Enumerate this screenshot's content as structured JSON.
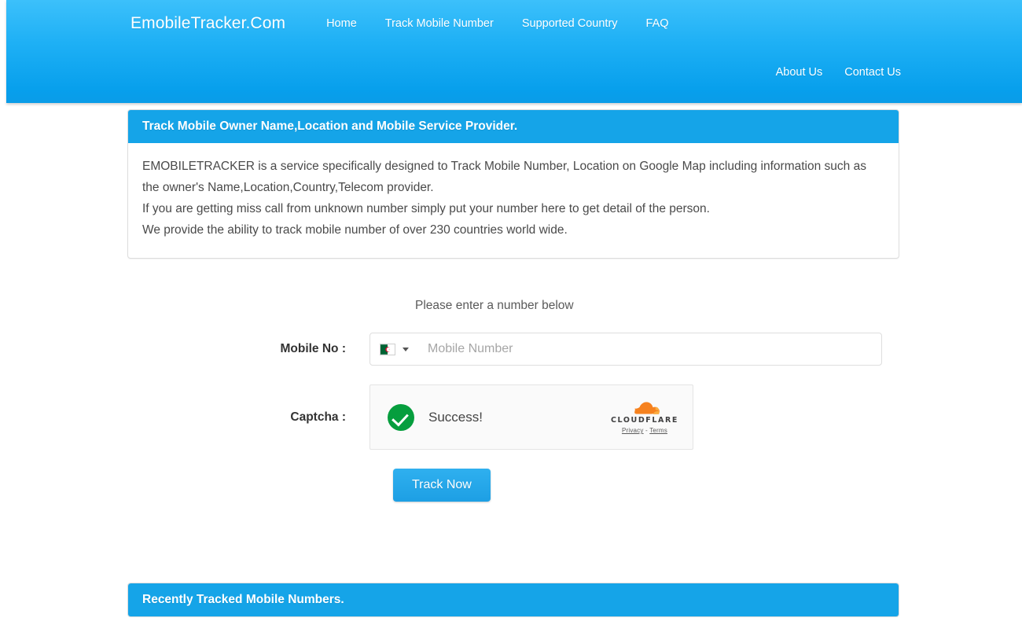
{
  "navbar": {
    "brand": "EmobileTracker.Com",
    "primary_links": [
      "Home",
      "Track Mobile Number",
      "Supported Country",
      "FAQ"
    ],
    "secondary_links": [
      "About Us",
      "Contact Us"
    ],
    "gradient_top": "#3cc0fb",
    "gradient_bottom": "#0a9ce8"
  },
  "info_panel": {
    "heading": "Track Mobile Owner Name,Location and Mobile Service Provider.",
    "heading_bg": "#15a4e8",
    "lines": [
      "EMOBILETRACKER is a service specifically designed to Track Mobile Number, Location on Google Map including information such as the owner's Name,Location,Country,Telecom provider.",
      "If you are getting miss call from unknown number simply put your number here to get detail of the person.",
      "We provide the ability to track mobile number of over 230 countries world wide."
    ]
  },
  "form": {
    "note": "Please enter a number below",
    "mobile_label": "Mobile No :",
    "mobile_placeholder": "Mobile Number",
    "mobile_value": "",
    "selected_country_flag": "algeria-flag-icon",
    "captcha_label": "Captcha :",
    "submit_label": "Track Now",
    "submit_color": "#1d9fe4"
  },
  "captcha": {
    "status_text": "Success!",
    "status_color": "#069e3e",
    "provider": "CLOUDFLARE",
    "privacy_label": "Privacy",
    "separator": "-",
    "terms_label": "Terms",
    "cloud_color": "#f6821f"
  },
  "recent_panel": {
    "heading": "Recently Tracked Mobile Numbers.",
    "heading_bg": "#15a4e8"
  }
}
